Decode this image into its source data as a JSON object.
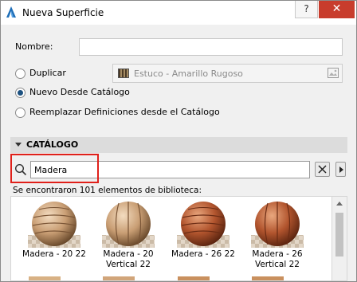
{
  "window": {
    "title": "Nueva Superficie",
    "help_label": "?",
    "close_label": "✕"
  },
  "form": {
    "name_label": "Nombre:",
    "name_value": "",
    "option_duplicate": "Duplicar",
    "duplicate_material": "Estuco - Amarillo Rugoso",
    "option_new_from_catalog": "Nuevo Desde Catálogo",
    "option_replace_from_catalog": "Reemplazar Definiciones desde el Catálogo",
    "selected_option": "Nuevo Desde Catálogo"
  },
  "catalog": {
    "section_title": "CATÁLOGO",
    "search_value": "Madera",
    "results_text": "Se encontraron 101 elementos de biblioteca:",
    "items": [
      {
        "label": "Madera - 20 22",
        "icon": "wood-sphere-light"
      },
      {
        "label": "Madera - 20 Vertical 22",
        "icon": "wood-sphere-light-vertical"
      },
      {
        "label": "Madera - 26 22",
        "icon": "wood-sphere-red"
      },
      {
        "label": "Madera - 26 Vertical 22",
        "icon": "wood-sphere-red-vertical"
      }
    ]
  },
  "colors": {
    "accent": "#1c5180",
    "highlight_border": "#e0201a",
    "close_button": "#c83c2c",
    "section_header": "#dcdcdc"
  }
}
